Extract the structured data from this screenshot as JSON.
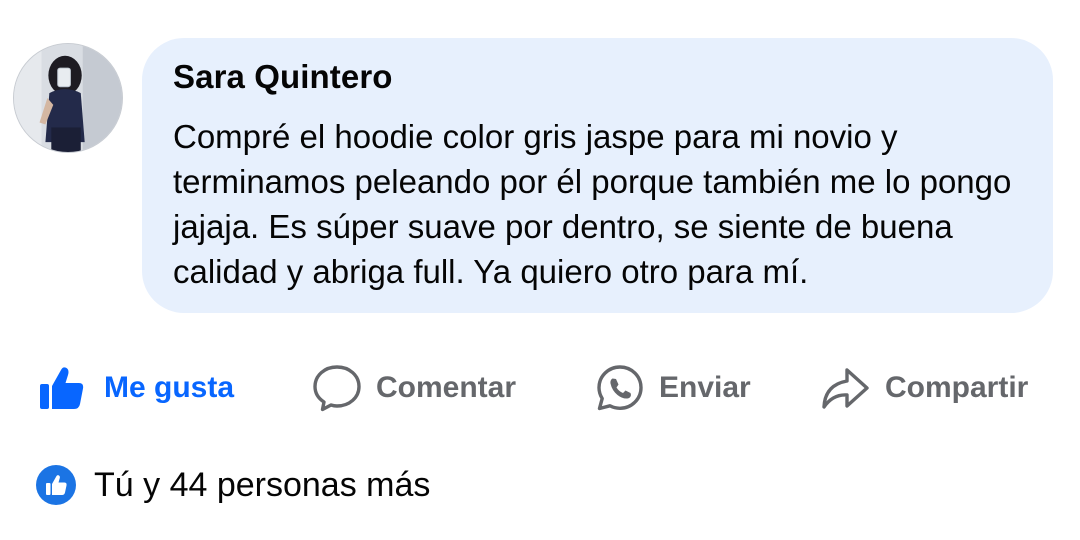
{
  "comment": {
    "author": "Sara Quintero",
    "text": "Compré el hoodie color gris jaspe para mi novio y terminamos peleando por él porque también me lo pongo jajaja. Es súper suave por dentro, se siente de buena calidad y abriga full. Ya quiero otro para mí."
  },
  "actions": {
    "like_label": "Me gusta",
    "comment_label": "Comentar",
    "send_label": "Enviar",
    "share_label": "Compartir"
  },
  "reactions": {
    "summary": "Tú y 44 personas más"
  },
  "colors": {
    "accent": "#0866ff",
    "bubble": "#e7f0fd",
    "muted": "#65676b"
  },
  "icons": {
    "like": "thumbs-up-icon",
    "comment": "speech-bubble-icon",
    "send": "whatsapp-icon",
    "share": "share-arrow-icon",
    "reaction": "like-reaction-icon"
  }
}
